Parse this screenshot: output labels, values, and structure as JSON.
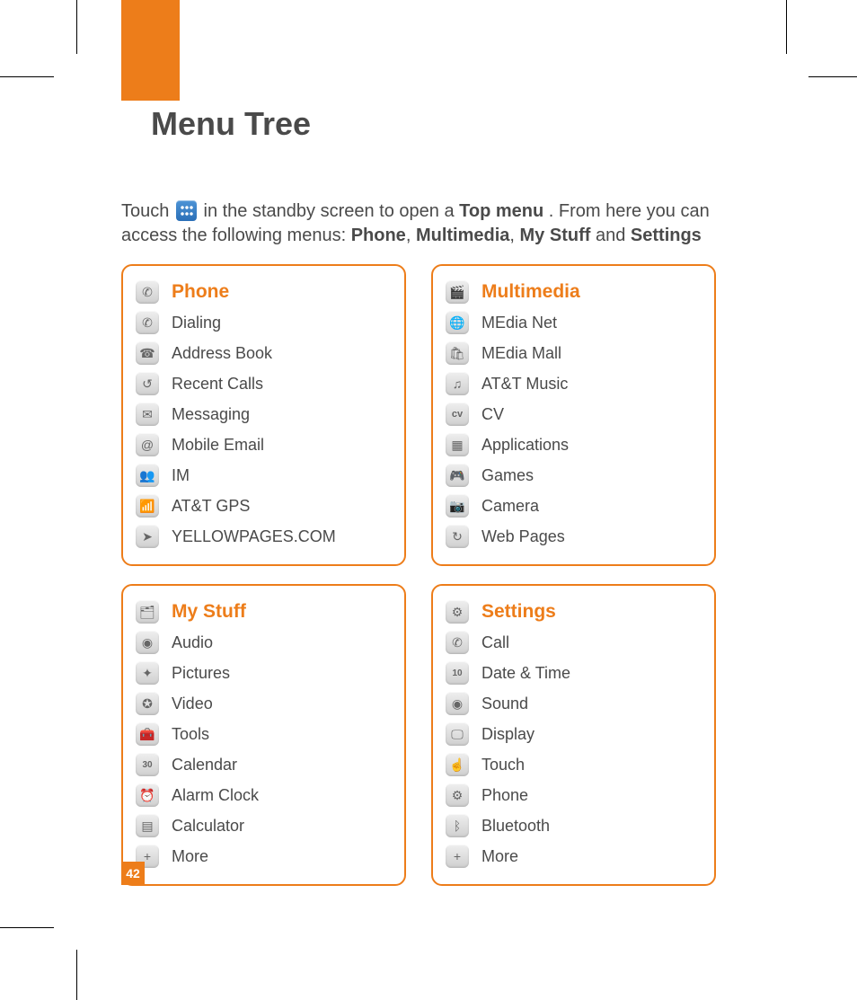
{
  "pageNumber": "42",
  "title": "Menu Tree",
  "intro": {
    "pre": "Touch ",
    "mid": " in the standby screen to open a ",
    "topMenu": "Top menu",
    "post1": ". From here you can access the following menus: ",
    "m1": "Phone",
    "m2": "Multimedia",
    "m3": "My Stuff",
    "and": " and ",
    "m4": "Settings"
  },
  "cards": {
    "phone": {
      "title": "Phone",
      "items": [
        {
          "label": "Dialing",
          "glyph": "✆"
        },
        {
          "label": "Address Book",
          "glyph": "☎"
        },
        {
          "label": "Recent Calls",
          "glyph": "↺"
        },
        {
          "label": "Messaging",
          "glyph": "✉"
        },
        {
          "label": "Mobile Email",
          "glyph": "@"
        },
        {
          "label": "IM",
          "glyph": "👥"
        },
        {
          "label": "AT&T GPS",
          "glyph": "📶"
        },
        {
          "label": "YELLOWPAGES.COM",
          "glyph": "➤"
        }
      ]
    },
    "multimedia": {
      "title": "Multimedia",
      "items": [
        {
          "label": "MEdia Net",
          "glyph": "🌐"
        },
        {
          "label": "MEdia Mall",
          "glyph": "🛍"
        },
        {
          "label": "AT&T Music",
          "glyph": "♫"
        },
        {
          "label": "CV",
          "glyph": "cv"
        },
        {
          "label": "Applications",
          "glyph": "▦"
        },
        {
          "label": "Games",
          "glyph": "🎮"
        },
        {
          "label": "Camera",
          "glyph": "📷"
        },
        {
          "label": "Web Pages",
          "glyph": "↻"
        }
      ]
    },
    "mystuff": {
      "title": "My Stuff",
      "items": [
        {
          "label": "Audio",
          "glyph": "◉"
        },
        {
          "label": "Pictures",
          "glyph": "✦"
        },
        {
          "label": "Video",
          "glyph": "✪"
        },
        {
          "label": "Tools",
          "glyph": "🧰"
        },
        {
          "label": "Calendar",
          "glyph": "30"
        },
        {
          "label": "Alarm Clock",
          "glyph": "⏰"
        },
        {
          "label": "Calculator",
          "glyph": "▤"
        },
        {
          "label": "More",
          "glyph": "+"
        }
      ]
    },
    "settings": {
      "title": "Settings",
      "items": [
        {
          "label": "Call",
          "glyph": "✆"
        },
        {
          "label": "Date & Time",
          "glyph": "10"
        },
        {
          "label": "Sound",
          "glyph": "◉"
        },
        {
          "label": "Display",
          "glyph": "🖵"
        },
        {
          "label": "Touch",
          "glyph": "☝"
        },
        {
          "label": "Phone",
          "glyph": "⚙"
        },
        {
          "label": "Bluetooth",
          "glyph": "ᛒ"
        },
        {
          "label": "More",
          "glyph": "+"
        }
      ]
    }
  }
}
